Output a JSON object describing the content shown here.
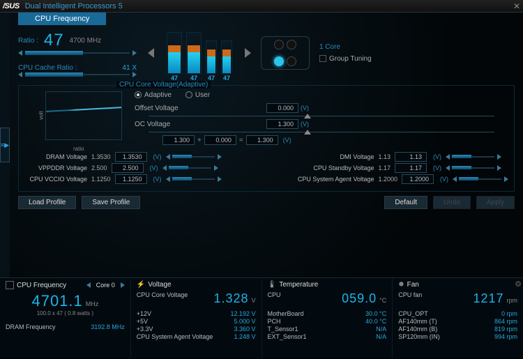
{
  "title": "Dual Intelligent Processors 5",
  "tab": "CPU Frequency",
  "ratio": {
    "label": "Ratio :",
    "value": "47",
    "mhz": "4700 MHz"
  },
  "cache": {
    "label": "CPU Cache Ratio :",
    "value": "41 X"
  },
  "cores": {
    "values": [
      "47",
      "47",
      "47",
      "47"
    ],
    "count_label": "1 Core",
    "group": "Group Tuning"
  },
  "volt": {
    "title": "CPU Core Voltage(Adaptive)",
    "mode_adaptive": "Adaptive",
    "mode_user": "User",
    "offset_label": "Offset Voltage",
    "offset": "0.000",
    "oc_label": "OC Voltage",
    "oc": "1.300",
    "eq1": "1.300",
    "eqplus": "0.000",
    "eqres": "1.300",
    "axis_v": "volt",
    "axis_r": "ratio"
  },
  "vrows_left": [
    {
      "name": "DRAM Voltage",
      "cur": "1.3530",
      "set": "1.3530"
    },
    {
      "name": "VPPDDR Voltage",
      "cur": "2.500",
      "set": "2.500"
    },
    {
      "name": "CPU VCCIO Voltage",
      "cur": "1.1250",
      "set": "1.1250"
    }
  ],
  "vrows_right": [
    {
      "name": "DMI Voltage",
      "cur": "1.13",
      "set": "1.13"
    },
    {
      "name": "CPU Standby Voltage",
      "cur": "1.17",
      "set": "1.17"
    },
    {
      "name": "CPU System Agent Voltage",
      "cur": "1.2000",
      "set": "1.2000"
    }
  ],
  "buttons": {
    "load": "Load Profile",
    "save": "Save Profile",
    "default": "Default",
    "undo": "Undo",
    "apply": "Apply"
  },
  "footer": {
    "freq": {
      "title": "CPU Frequency",
      "core": "Core 0",
      "mhz": "4701.1",
      "detail": "100.0 x 47  ( 0.8   watts )",
      "dram_label": "DRAM Frequency",
      "dram": "3192.8 MHz"
    },
    "volt": {
      "title": "Voltage",
      "main_label": "CPU Core Voltage",
      "main": "1.328",
      "rows": [
        {
          "n": "+12V",
          "v": "12.192 V"
        },
        {
          "n": "+5V",
          "v": "5.000 V"
        },
        {
          "n": "+3.3V",
          "v": "3.360 V"
        },
        {
          "n": "CPU System Agent Voltage",
          "v": "1.248 V"
        }
      ]
    },
    "temp": {
      "title": "Temperature",
      "main_label": "CPU",
      "main": "059.0",
      "rows": [
        {
          "n": "MotherBoard",
          "v": "30.0 °C"
        },
        {
          "n": "PCH",
          "v": "40.0 °C"
        },
        {
          "n": "T_Sensor1",
          "v": "N/A"
        },
        {
          "n": "EXT_Sensor1",
          "v": "N/A"
        }
      ]
    },
    "fan": {
      "title": "Fan",
      "main_label": "CPU fan",
      "main": "1217",
      "rows": [
        {
          "n": "CPU_OPT",
          "v": "0 rpm"
        },
        {
          "n": "AF140mm (T)",
          "v": "864 rpm"
        },
        {
          "n": "AF140mm (B)",
          "v": "819 rpm"
        },
        {
          "n": "SP120mm (IN)",
          "v": "994 rpm"
        }
      ]
    }
  }
}
